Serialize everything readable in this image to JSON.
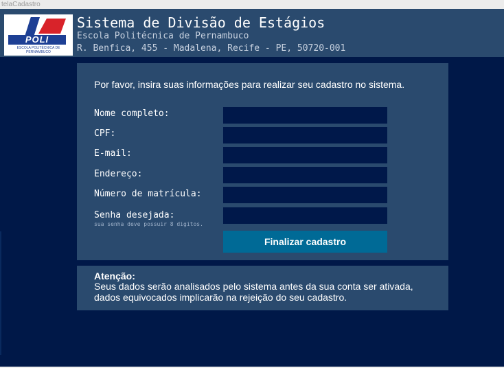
{
  "window": {
    "title": "telaCadastro"
  },
  "header": {
    "logo_text": "POLI",
    "logo_subtext": "ESCOLA POLITÉCNICA DE PERNAMBUCO",
    "title": "Sistema de Divisão de Estágios",
    "school": "Escola Politécnica de Pernambuco",
    "address": "R. Benfica, 455 - Madalena, Recife - PE, 50720-001"
  },
  "form": {
    "intro": "Por favor, insira suas informações para realizar seu cadastro no sistema.",
    "fields": [
      {
        "label": "Nome completo:",
        "value": ""
      },
      {
        "label": "CPF:",
        "value": ""
      },
      {
        "label": "E-mail:",
        "value": ""
      },
      {
        "label": "Endereço:",
        "value": ""
      },
      {
        "label": "Número de matrícula:",
        "value": ""
      },
      {
        "label": "Senha desejada:",
        "value": ""
      }
    ],
    "password_hint": "sua senha deve possuir 8 digitos.",
    "submit_label": "Finalizar cadastro"
  },
  "notice": {
    "title": "Atenção:",
    "text": "Seus dados serão analisados pelo sistema antes da sua conta ser ativada, dados equivocados implicarão na rejeição do seu cadastro."
  },
  "colors": {
    "background": "#001848",
    "panel": "#2a4a6e",
    "input": "#00184a",
    "button": "#006a96"
  }
}
